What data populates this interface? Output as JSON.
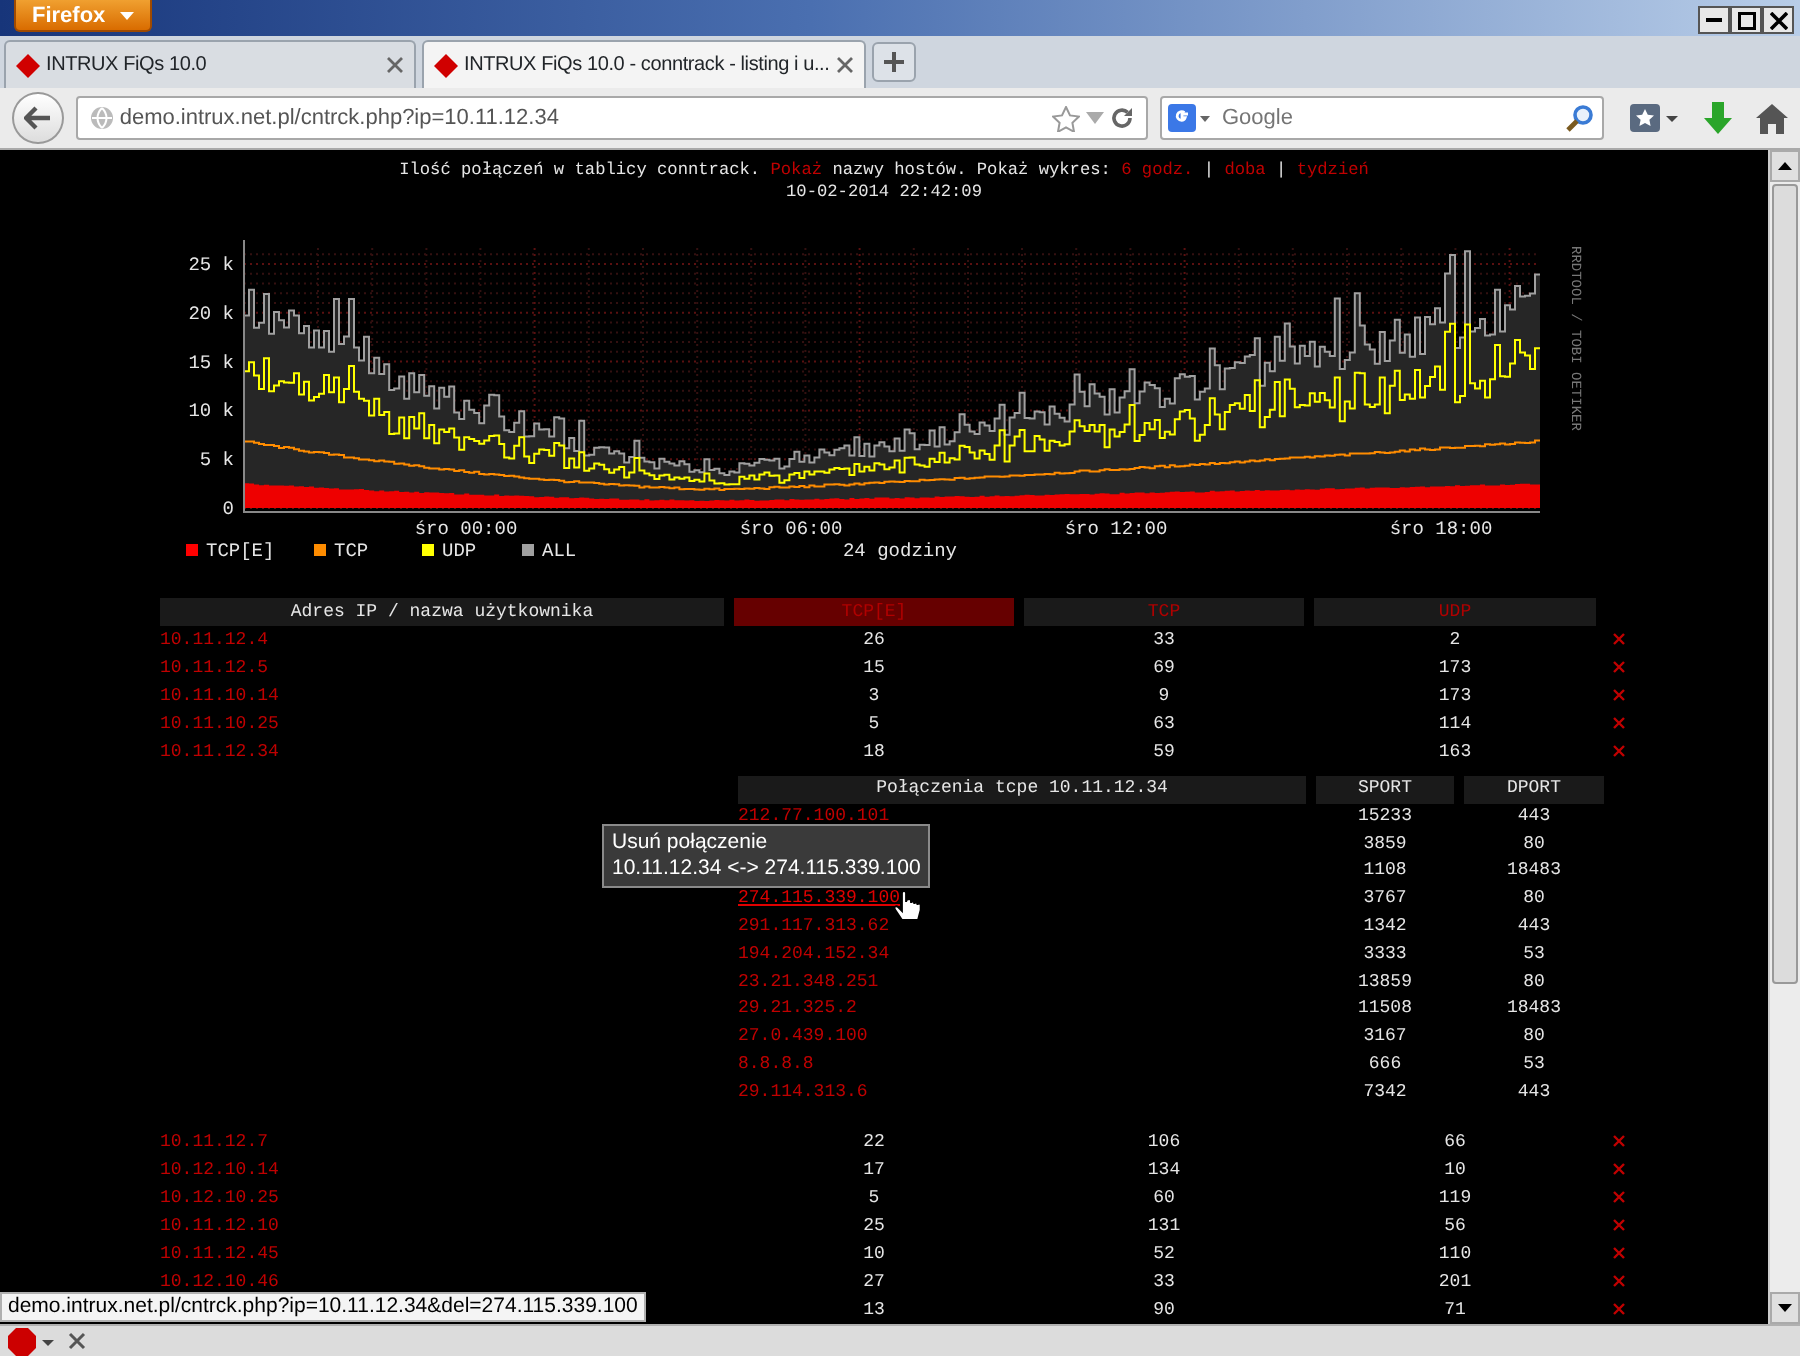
{
  "browser": {
    "menu_button": "Firefox",
    "tabs": [
      {
        "title": "INTRUX FiQs 10.0",
        "selected": false
      },
      {
        "title": "INTRUX FiQs 10.0 - conntrack - listing i u...",
        "selected": true
      }
    ],
    "url": "demo.intrux.net.pl/cntrck.php?ip=10.11.12.34",
    "search_placeholder": "Google"
  },
  "header": {
    "text_before": "Ilość połączeń w tablicy conntrack.",
    "show_link": "Pokaż",
    "text_after": "nazwy hostów. Pokaż wykres:",
    "range_links": [
      {
        "label": "6 godz."
      },
      {
        "label": "doba",
        "separator": "|"
      },
      {
        "label": "tydzień",
        "separator": "|"
      }
    ],
    "timestamp": "10-02-2014 22:42:09"
  },
  "graph": {
    "y_axis_labels": [
      "25 k",
      "20 k",
      "15 k",
      "10 k",
      "5 k",
      "0"
    ],
    "x_axis_labels": [
      "śro 00:00",
      "śro 06:00",
      "śro 12:00",
      "śro 18:00"
    ],
    "legend": [
      {
        "label": "TCP[E]",
        "color": "#ff0000"
      },
      {
        "label": "TCP",
        "color": "#ff8c00"
      },
      {
        "label": "UDP",
        "color": "#ffff00"
      },
      {
        "label": "ALL",
        "color": "#a0a0a0"
      }
    ],
    "caption": "24 godziny",
    "credit": "RRDTOOL / TOBI OETIKER"
  },
  "hosts_table": {
    "columns": [
      {
        "label": "Adres IP / nazwa użytkownika",
        "selected": false
      },
      {
        "label": "TCP[E]",
        "selected": true
      },
      {
        "label": "TCP",
        "selected": false
      },
      {
        "label": "UDP",
        "selected": false
      }
    ],
    "rows": [
      {
        "host": "10.11.12.4",
        "tcp_e": "26",
        "tcp": "33",
        "udp": "2"
      },
      {
        "host": "10.11.12.5",
        "tcp_e": "15",
        "tcp": "69",
        "udp": "173"
      },
      {
        "host": "10.11.10.14",
        "tcp_e": "3",
        "tcp": "9",
        "udp": "173"
      },
      {
        "host": "10.11.10.25",
        "tcp_e": "5",
        "tcp": "63",
        "udp": "114"
      },
      {
        "host": "10.11.12.34",
        "tcp_e": "18",
        "tcp": "59",
        "udp": "163",
        "connections": {
          "title": "Połączenia tcpe 10.11.12.34",
          "columns": [
            "SPORT",
            "DPORT"
          ],
          "rows": [
            {
              "remote": "212.77.100.101",
              "sport": "15233",
              "dport": "443",
              "hovered": false
            },
            {
              "sport": "3859",
              "dport": "80"
            },
            {
              "sport": "1108",
              "dport": "18483"
            },
            {
              "remote": "274.115.339.100",
              "sport": "3767",
              "dport": "80",
              "hovered": true
            },
            {
              "remote": "291.117.313.62",
              "sport": "1342",
              "dport": "443",
              "hovered": false
            },
            {
              "remote": "194.204.152.34",
              "sport": "3333",
              "dport": "53",
              "hovered": false
            },
            {
              "remote": "23.21.348.251",
              "sport": "13859",
              "dport": "80",
              "hovered": false
            },
            {
              "remote": "29.21.325.2",
              "sport": "11508",
              "dport": "18483",
              "hovered": false
            },
            {
              "remote": "27.0.439.100",
              "sport": "3167",
              "dport": "80",
              "hovered": false
            },
            {
              "remote": "8.8.8.8",
              "sport": "666",
              "dport": "53",
              "hovered": false
            },
            {
              "remote": "29.114.313.6",
              "sport": "7342",
              "dport": "443",
              "hovered": false
            }
          ]
        }
      },
      {
        "host": "10.11.12.7",
        "tcp_e": "22",
        "tcp": "106",
        "udp": "66"
      },
      {
        "host": "10.12.10.14",
        "tcp_e": "17",
        "tcp": "134",
        "udp": "10"
      },
      {
        "host": "10.12.10.25",
        "tcp_e": "5",
        "tcp": "60",
        "udp": "119"
      },
      {
        "host": "10.11.12.10",
        "tcp_e": "25",
        "tcp": "131",
        "udp": "56"
      },
      {
        "host": "10.11.12.45",
        "tcp_e": "10",
        "tcp": "52",
        "udp": "110"
      },
      {
        "host": "10.12.10.46",
        "tcp_e": "27",
        "tcp": "33",
        "udp": "201"
      },
      {
        "tcp_e": "13",
        "tcp": "90",
        "udp": "71"
      }
    ]
  },
  "tooltip": {
    "title": "Usuń połączenie",
    "text": "10.11.12.34 <-> 274.115.339.100"
  },
  "status_url": "demo.intrux.net.pl/cntrck.php?ip=10.11.12.34&del=274.115.339.100"
}
